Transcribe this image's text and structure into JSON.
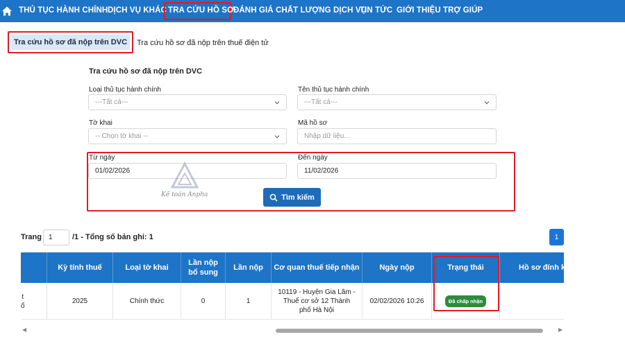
{
  "nav": {
    "items": [
      "THỦ TỤC HÀNH CHÍNH",
      "DỊCH VỤ KHÁC",
      "TRA CỨU HỒ SƠ",
      "ĐÁNH GIÁ CHẤT LƯỢNG DỊCH VỤ",
      "TIN TỨC",
      "GIỚI THIỆU",
      "TRỢ GIÚP"
    ],
    "active": "TRA CỨU HỒ SƠ",
    "home_icon": "home-icon"
  },
  "tabs": {
    "active": "Tra cứu hồ sơ đã nộp trên DVC",
    "other": "Tra cứu hồ sơ đã nộp trên thuế điện tử"
  },
  "form": {
    "title": "Tra cứu hồ sơ đã nộp trên DVC",
    "procedure_type": {
      "label": "Loại thủ tục hành chính",
      "value": "---Tất cả---"
    },
    "procedure_name": {
      "label": "Tên thủ tục hành chính",
      "value": "---Tất cả---"
    },
    "form_type": {
      "label": "Tờ khai",
      "value": "-- Chọn tờ khai --"
    },
    "file_code": {
      "label": "Mã hồ sơ",
      "placeholder": "Nhập dữ liệu..."
    },
    "from_date": {
      "label": "Từ ngày",
      "value": "01/02/2026"
    },
    "to_date": {
      "label": "Đến ngày",
      "value": "11/02/2026"
    },
    "search_label": "Tìm kiếm"
  },
  "watermark": {
    "text": "Kế toán Anpha"
  },
  "pagination": {
    "prefix": "Trang",
    "page": "1",
    "suffix": "/1 - Tổng số bản ghi: 1",
    "current_button": "1"
  },
  "table": {
    "headers": [
      "",
      "Kỳ tính thuế",
      "Loại tờ khai",
      "Lần nộp bổ sung",
      "Lần nộp",
      "Cơ quan thuế tiếp nhận",
      "Ngày nộp",
      "Trạng thái",
      "Hồ sơ đính kèm"
    ],
    "row": {
      "cut_col": "t\nố",
      "period": "2025",
      "type": "Chính thức",
      "supplement": "0",
      "attempt": "1",
      "agency": "10119 - Huyện Gia Lâm - Thuế cơ sở 12 Thành phố Hà Nội",
      "date": "02/02/2026 10:26",
      "status": "Đã chấp nhận",
      "attachment": ""
    }
  },
  "colors": {
    "primary": "#1e74c6",
    "highlight": "#e01b24",
    "status_ok": "#2e8b3e"
  }
}
